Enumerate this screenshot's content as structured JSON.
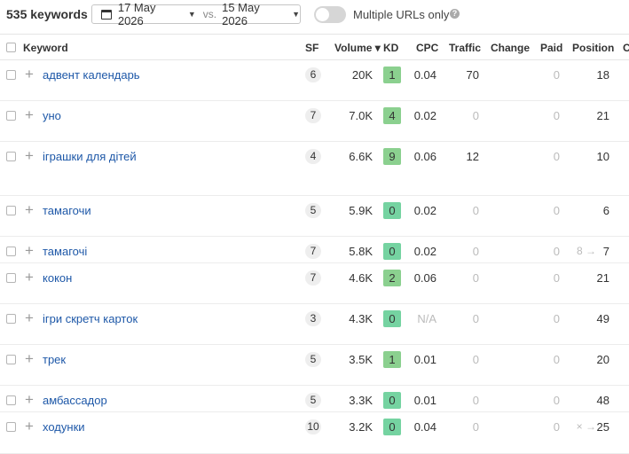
{
  "toolbar": {
    "keyword_count": "535 keywords",
    "date_from": "17 May 2026",
    "vs_label": "vs.",
    "date_to": "15 May 2026",
    "toggle_label": "Multiple URLs only",
    "toggle_on": false
  },
  "table": {
    "columns": {
      "keyword": "Keyword",
      "sf": "SF",
      "volume": "Volume ▾",
      "kd": "KD",
      "cpc": "CPC",
      "traffic": "Traffic",
      "change": "Change",
      "paid": "Paid",
      "position": "Position",
      "extra": "C"
    },
    "rows": [
      {
        "keyword": "адвент календарь",
        "sf": "6",
        "volume": "20K",
        "kd": "1",
        "cpc": "0.04",
        "traffic": "70",
        "paid": "0",
        "position": "18",
        "prev_position": ""
      },
      {
        "keyword": "уно",
        "sf": "7",
        "volume": "7.0K",
        "kd": "4",
        "cpc": "0.02",
        "traffic": "0",
        "paid": "0",
        "position": "21",
        "prev_position": ""
      },
      {
        "keyword": "іграшки для дітей",
        "sf": "4",
        "volume": "6.6K",
        "kd": "9",
        "cpc": "0.06",
        "traffic": "12",
        "paid": "0",
        "position": "10",
        "prev_position": ""
      },
      {
        "keyword": "тамагочи",
        "sf": "5",
        "volume": "5.9K",
        "kd": "0",
        "cpc": "0.02",
        "traffic": "0",
        "paid": "0",
        "position": "6",
        "prev_position": ""
      },
      {
        "keyword": "тамагочі",
        "sf": "7",
        "volume": "5.8K",
        "kd": "0",
        "cpc": "0.02",
        "traffic": "0",
        "paid": "0",
        "position": "7",
        "prev_position": "8 →"
      },
      {
        "keyword": "кокон",
        "sf": "7",
        "volume": "4.6K",
        "kd": "2",
        "cpc": "0.06",
        "traffic": "0",
        "paid": "0",
        "position": "21",
        "prev_position": ""
      },
      {
        "keyword": "ігри скретч карток",
        "sf": "3",
        "volume": "4.3K",
        "kd": "0",
        "cpc": "N/A",
        "traffic": "0",
        "paid": "0",
        "position": "49",
        "prev_position": ""
      },
      {
        "keyword": "трек",
        "sf": "5",
        "volume": "3.5K",
        "kd": "1",
        "cpc": "0.01",
        "traffic": "0",
        "paid": "0",
        "position": "20",
        "prev_position": ""
      },
      {
        "keyword": "амбассадор",
        "sf": "5",
        "volume": "3.3K",
        "kd": "0",
        "cpc": "0.01",
        "traffic": "0",
        "paid": "0",
        "position": "48",
        "prev_position": ""
      },
      {
        "keyword": "ходунки",
        "sf": "10",
        "volume": "3.2K",
        "kd": "0",
        "cpc": "0.04",
        "traffic": "0",
        "paid": "0",
        "position": "25",
        "prev_position": "× →"
      }
    ]
  },
  "colors": {
    "link": "#1e58a8",
    "kd_easy": "#75d3a1",
    "kd_low": "#8bd08f",
    "muted": "#bbbbbb"
  },
  "icons": {
    "date": "calendar-icon",
    "help": "question-circle-icon",
    "add": "plus-icon"
  }
}
